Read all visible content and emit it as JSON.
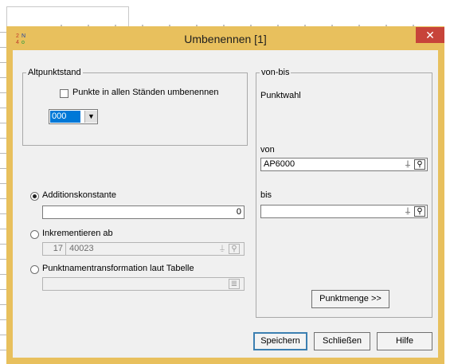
{
  "window": {
    "title": "Umbenennen [1]",
    "close_glyph": "✕"
  },
  "altpunktstand": {
    "legend": "Altpunktstand",
    "checkbox_label": "Punkte in allen Ständen umbenennen",
    "checkbox_checked": false,
    "select_value": "000"
  },
  "options": {
    "additionskonstante": {
      "label": "Additionskonstante",
      "value": "0",
      "selected": true
    },
    "inkrementieren": {
      "label": "Inkrementieren ab",
      "prefix": "17",
      "value": "40023",
      "selected": false
    },
    "transformation": {
      "label": "Punktnamentransformation laut Tabelle",
      "value": "",
      "selected": false
    }
  },
  "vonbis": {
    "legend": "von-bis",
    "punktwahl": "Punktwahl",
    "von_label": "von",
    "von_value": "AP6000",
    "bis_label": "bis",
    "bis_value": "",
    "punktmenge_button": "Punktmenge >>"
  },
  "footer": {
    "save": "Speichern",
    "close": "Schließen",
    "help": "Hilfe"
  },
  "colors": {
    "frame": "#e8c05d",
    "close": "#c7443a",
    "client": "#f0f0f0"
  },
  "icons": [
    "app-icon",
    "pick-point-icon",
    "search-icon",
    "table-icon",
    "close-icon",
    "dropdown-arrow-icon"
  ]
}
